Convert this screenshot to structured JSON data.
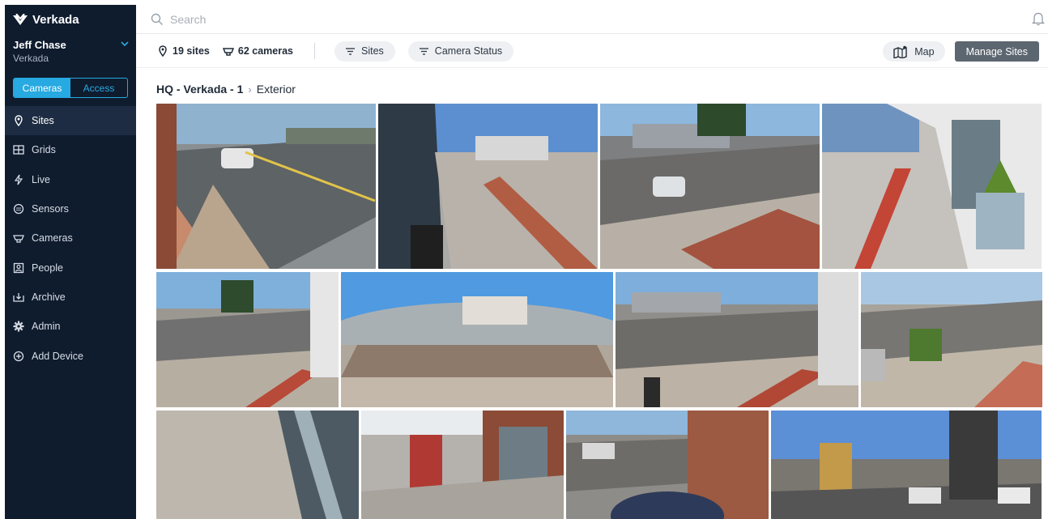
{
  "brand": {
    "name": "Verkada"
  },
  "account": {
    "name": "Jeff Chase",
    "org": "Verkada"
  },
  "segment": {
    "active": "Cameras",
    "inactive": "Access"
  },
  "nav": [
    {
      "label": "Sites",
      "icon": "map-pin-icon",
      "active": true
    },
    {
      "label": "Grids",
      "icon": "grid-icon",
      "active": false
    },
    {
      "label": "Live",
      "icon": "bolt-icon",
      "active": false
    },
    {
      "label": "Sensors",
      "icon": "sensor-icon",
      "active": false
    },
    {
      "label": "Cameras",
      "icon": "camera-icon",
      "active": false
    },
    {
      "label": "People",
      "icon": "person-icon",
      "active": false
    },
    {
      "label": "Archive",
      "icon": "archive-icon",
      "active": false
    },
    {
      "label": "Admin",
      "icon": "gear-icon",
      "active": false
    },
    {
      "label": "Add Device",
      "icon": "plus-circle-icon",
      "active": false
    }
  ],
  "search": {
    "placeholder": "Search"
  },
  "filters": {
    "sites_count": "19 sites",
    "cameras_count": "62 cameras",
    "sites_filter": "Sites",
    "status_filter": "Camera Status",
    "map_label": "Map",
    "manage_label": "Manage Sites"
  },
  "breadcrumb": {
    "site": "HQ - Verkada - 1",
    "area": "Exterior"
  },
  "colors": {
    "sidebar": "#0f1c2e",
    "accent": "#27a9e1",
    "active_nav": "#1d2c42"
  }
}
